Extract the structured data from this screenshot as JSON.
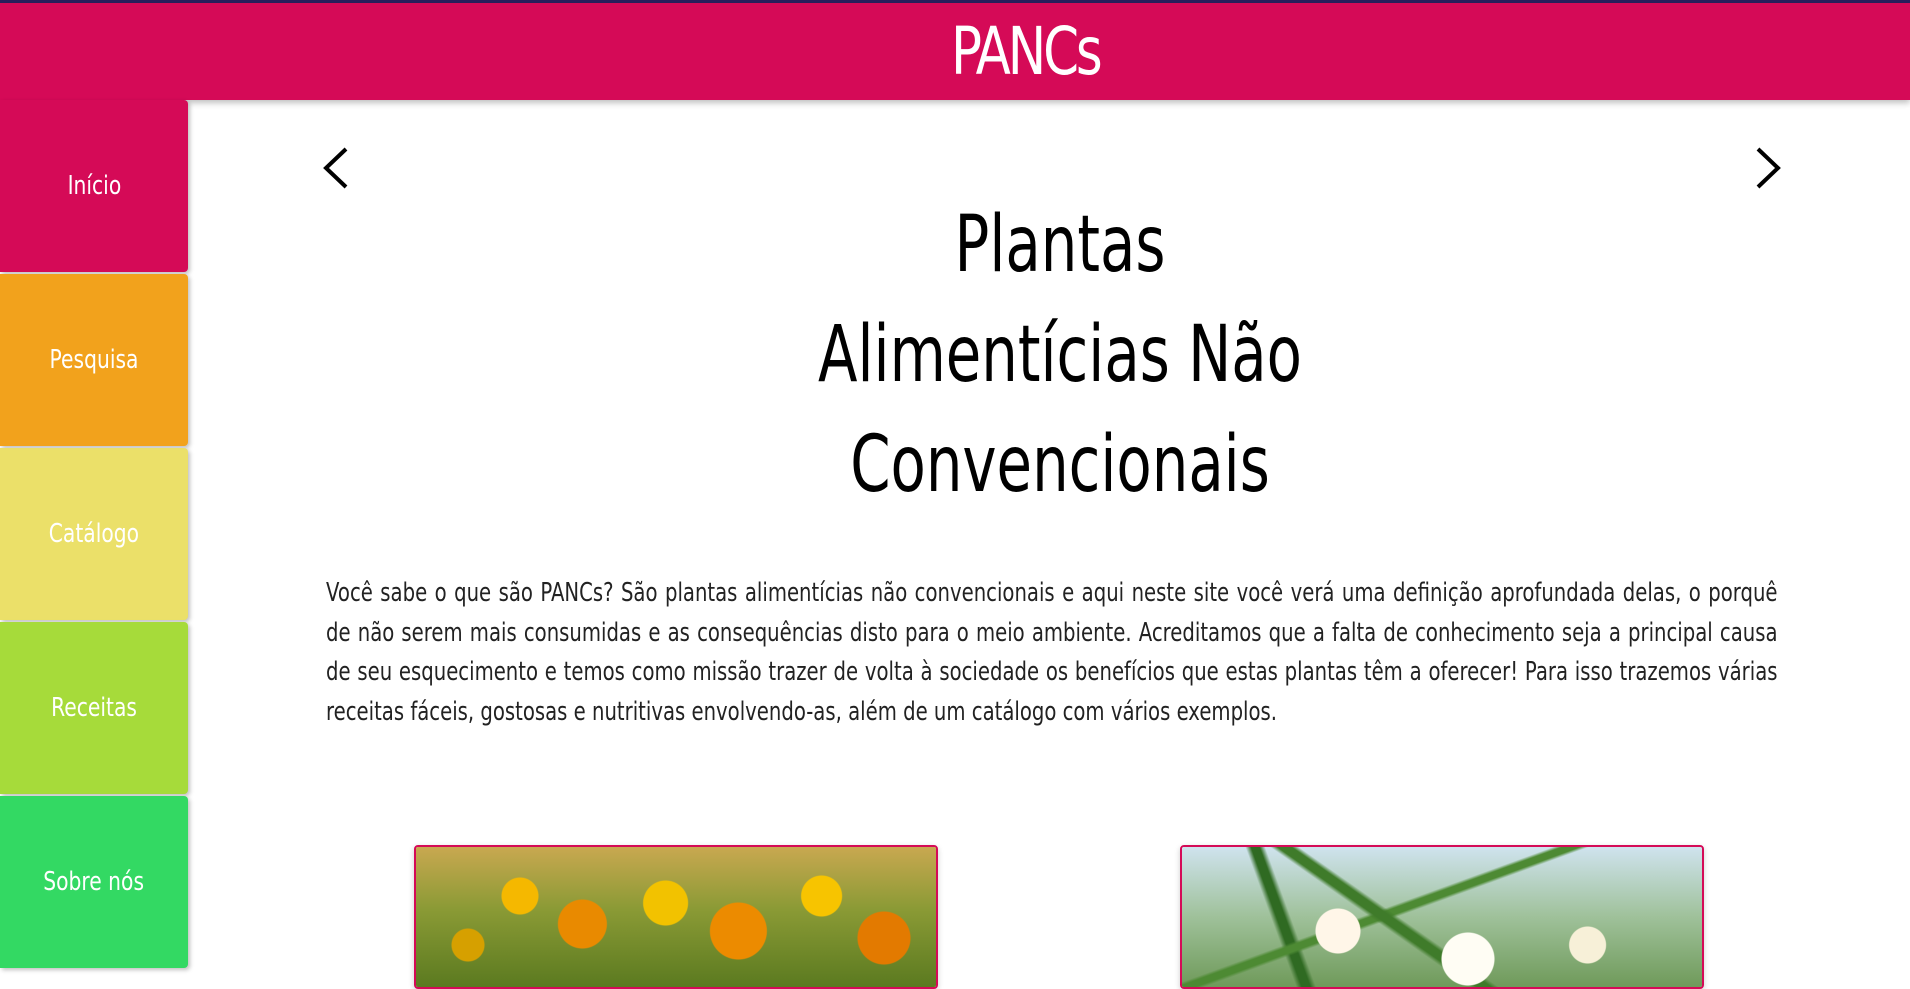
{
  "header": {
    "title": "PANCs",
    "accent_color": "#d50a57"
  },
  "sidebar": {
    "items": [
      {
        "label": "Início",
        "color": "#d50a57"
      },
      {
        "label": "Pesquisa",
        "color": "#f2a21c"
      },
      {
        "label": "Catálogo",
        "color": "#ebe069"
      },
      {
        "label": "Receitas",
        "color": "#a6db3a"
      },
      {
        "label": "Sobre nós",
        "color": "#33d963"
      }
    ]
  },
  "carousel": {
    "prev_icon": "chevron-left-icon",
    "next_icon": "chevron-right-icon",
    "title_lines": [
      "Plantas",
      "Alimentícias Não",
      "Convencionais"
    ]
  },
  "intro": {
    "text": "Você sabe o que são PANCs? São plantas alimentícias não convencionais e aqui neste site você verá uma definição aprofundada delas, o porquê de não serem mais consumidas e as consequências disto para o meio ambiente. Acreditamos que a falta de conhecimento seja a principal causa de seu esquecimento e temos como missão trazer de volta à sociedade os benefícios que estas plantas têm a oferecer! Para isso trazemos várias receitas fáceis, gostosas e nutritivas envolvendo-as, além de um catálogo com vários exemplos."
  },
  "cards": [
    {
      "image": "yellow-marigold-flowers-photo"
    },
    {
      "image": "white-flowers-green-branches-photo"
    }
  ]
}
